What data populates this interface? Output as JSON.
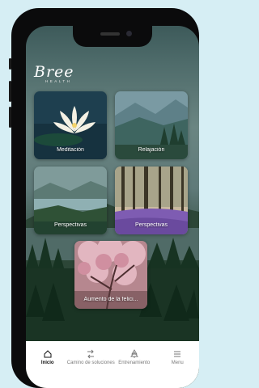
{
  "brand": {
    "name": "Bree",
    "subtitle": "HEALTH"
  },
  "cards": [
    {
      "label": "Meditación",
      "image": "water-lily"
    },
    {
      "label": "Relajación",
      "image": "misty-forest"
    },
    {
      "label": "Perspectivas",
      "image": "mountain-lake"
    },
    {
      "label": "Perspectivas",
      "image": "lavender-forest"
    },
    {
      "label": "Aumento de la felici...",
      "image": "cherry-blossom"
    }
  ],
  "tabbar": {
    "items": [
      {
        "label": "Inicio",
        "icon": "home-icon",
        "active": true
      },
      {
        "label": "Camino de soluciones",
        "icon": "path-icon",
        "active": false
      },
      {
        "label": "Entrenamiento",
        "icon": "tree-icon",
        "active": false
      },
      {
        "label": "Menu",
        "icon": "menu-icon",
        "active": false
      }
    ]
  },
  "colors": {
    "background": "#d6eef4",
    "active_tab": "#111111",
    "inactive_tab": "#7a7a7a"
  }
}
